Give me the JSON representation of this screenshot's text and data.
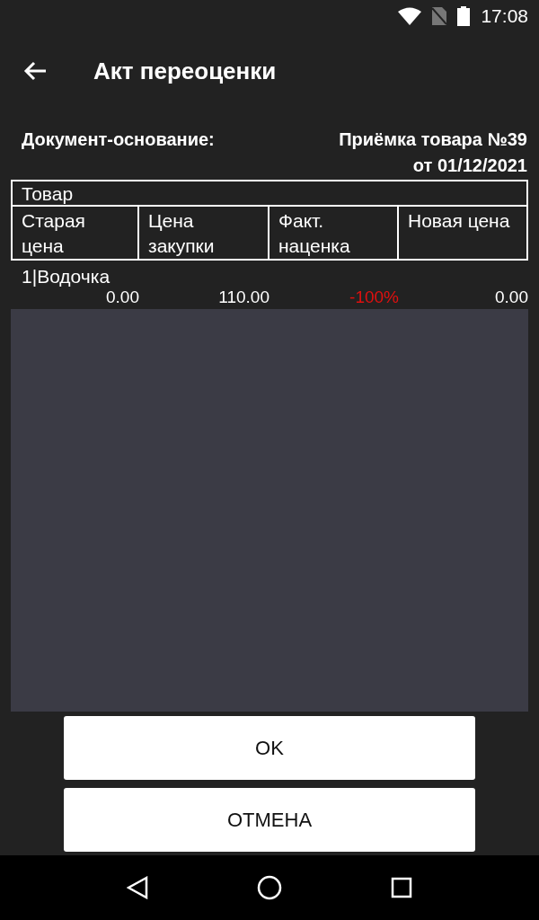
{
  "status_bar": {
    "time": "17:08"
  },
  "app_bar": {
    "title": "Акт переоценки"
  },
  "document": {
    "label": "Документ-основание:",
    "value_line_1": "Приёмка товара №39",
    "value_line_2": "от 01/12/2021"
  },
  "table": {
    "header": "Товар",
    "columns": [
      {
        "line_1": "Старая",
        "line_2": "цена"
      },
      {
        "line_1": "Цена",
        "line_2": "закупки"
      },
      {
        "line_1": "Факт.",
        "line_2": "наценка"
      },
      {
        "line_1": "Новая цена"
      }
    ],
    "rows": [
      {
        "name": "1|Водочка",
        "values": [
          {
            "text": "0.00",
            "color": "#ffffff"
          },
          {
            "text": "110.00",
            "color": "#ffffff"
          },
          {
            "text": "-100%",
            "color": "#e0100f"
          },
          {
            "text": "0.00",
            "color": "#ffffff"
          }
        ]
      }
    ]
  },
  "buttons": [
    "OK",
    "ОТМЕНА"
  ]
}
